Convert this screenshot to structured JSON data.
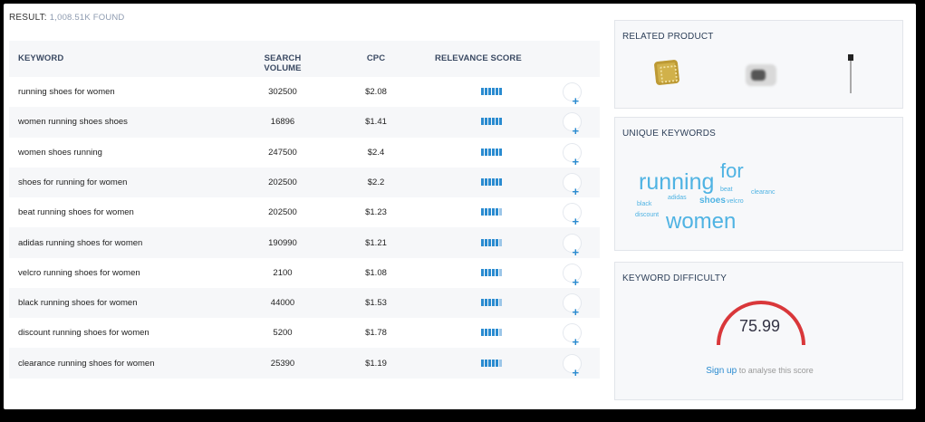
{
  "result": {
    "label": "RESULT:",
    "count": "1,008.51K FOUND"
  },
  "table": {
    "headers": {
      "keyword": "KEYWORD",
      "volume": "SEARCH VOLUME",
      "cpc": "CPC",
      "relevance": "RELEVANCE SCORE"
    },
    "rows": [
      {
        "keyword": "running shoes for women",
        "volume": "302500",
        "cpc": "$2.08",
        "relevance_bars": 6
      },
      {
        "keyword": "women running shoes shoes",
        "volume": "16896",
        "cpc": "$1.41",
        "relevance_bars": 6
      },
      {
        "keyword": "women shoes running",
        "volume": "247500",
        "cpc": "$2.4",
        "relevance_bars": 6
      },
      {
        "keyword": "shoes for running for women",
        "volume": "202500",
        "cpc": "$2.2",
        "relevance_bars": 6
      },
      {
        "keyword": "beat running shoes for women",
        "volume": "202500",
        "cpc": "$1.23",
        "relevance_bars": 5
      },
      {
        "keyword": "adidas running shoes for women",
        "volume": "190990",
        "cpc": "$1.21",
        "relevance_bars": 5
      },
      {
        "keyword": "velcro running shoes for women",
        "volume": "2100",
        "cpc": "$1.08",
        "relevance_bars": 5
      },
      {
        "keyword": "black running shoes for women",
        "volume": "44000",
        "cpc": "$1.53",
        "relevance_bars": 5
      },
      {
        "keyword": "discount running shoes for women",
        "volume": "5200",
        "cpc": "$1.78",
        "relevance_bars": 5
      },
      {
        "keyword": "clearance running shoes for women",
        "volume": "25390",
        "cpc": "$1.19",
        "relevance_bars": 5
      }
    ],
    "add_icon": "plus-icon",
    "add_symbol": "+"
  },
  "related_product": {
    "title": "RELATED PRODUCT",
    "items": [
      "pillow-thumbnail",
      "mug-thumbnail",
      "stand-thumbnail"
    ]
  },
  "unique_keywords": {
    "title": "UNIQUE KEYWORDS",
    "words": {
      "running": "running",
      "for": "for",
      "women": "women",
      "shoes": "shoes",
      "beat": "beat",
      "adidas": "adidas",
      "velcro": "velcro",
      "clearance": "clearanc",
      "black": "black",
      "discount": "discount"
    }
  },
  "keyword_difficulty": {
    "title": "KEYWORD DIFFICULTY",
    "value": "75.99",
    "gauge_color": "#d9373a",
    "signup_link": "Sign up",
    "signup_text": " to analyse this score"
  },
  "colors": {
    "accent": "#2a8bd0",
    "cloud": "#4fb3e3",
    "gauge": "#d9373a"
  }
}
